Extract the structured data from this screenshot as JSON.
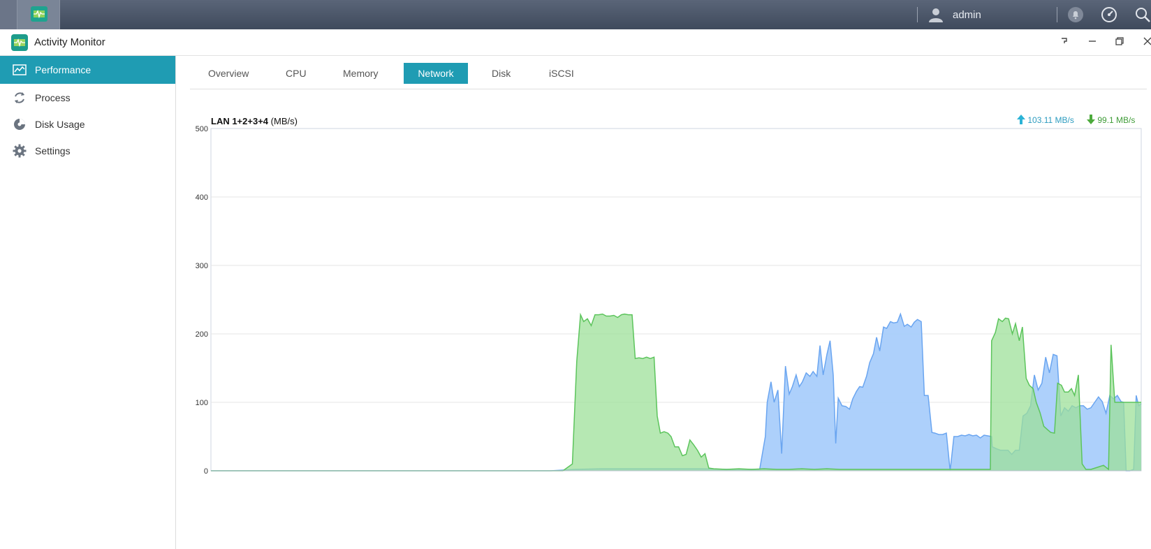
{
  "taskbar": {
    "user_name": "admin"
  },
  "window": {
    "title": "Activity Monitor"
  },
  "sidebar": {
    "items": [
      {
        "label": "Performance",
        "icon": "performance-chart-icon",
        "active": true
      },
      {
        "label": "Process",
        "icon": "process-refresh-icon",
        "active": false
      },
      {
        "label": "Disk Usage",
        "icon": "disk-usage-icon",
        "active": false
      },
      {
        "label": "Settings",
        "icon": "gear-icon",
        "active": false
      }
    ]
  },
  "tabs": [
    {
      "label": "Overview",
      "active": false
    },
    {
      "label": "CPU",
      "active": false
    },
    {
      "label": "Memory",
      "active": false
    },
    {
      "label": "Network",
      "active": true
    },
    {
      "label": "Disk",
      "active": false
    },
    {
      "label": "iSCSI",
      "active": false
    }
  ],
  "chart_data": {
    "type": "area",
    "title": "LAN 1+2+3+4",
    "unit": "(MB/s)",
    "ylim": [
      0,
      500
    ],
    "yticks": [
      "500",
      "400",
      "300",
      "200",
      "100",
      "0"
    ],
    "grid": true,
    "legend": [
      {
        "value": "103.11 MB/s",
        "direction": "up",
        "color": "#2bb3d6"
      },
      {
        "value": "99.1 MB/s",
        "direction": "down",
        "color": "#4caa3c"
      }
    ],
    "series": [
      {
        "color": "#6aa5f0",
        "fill": "#a9cdfb",
        "points": [
          [
            0,
            0
          ],
          [
            51,
            0
          ],
          [
            54,
            0
          ],
          [
            58,
            2
          ],
          [
            62,
            3
          ],
          [
            66,
            3
          ],
          [
            70,
            3
          ],
          [
            74,
            3
          ],
          [
            78,
            3
          ],
          [
            82,
            2
          ],
          [
            86,
            2
          ],
          [
            87.3,
            2
          ],
          [
            88.2,
            50
          ],
          [
            88.5,
            100
          ],
          [
            89.1,
            130
          ],
          [
            89.6,
            100
          ],
          [
            90.2,
            118
          ],
          [
            90.8,
            25
          ],
          [
            91.4,
            153
          ],
          [
            92.0,
            112
          ],
          [
            92.5,
            123
          ],
          [
            93.1,
            140
          ],
          [
            93.6,
            123
          ],
          [
            94.1,
            130
          ],
          [
            94.7,
            143
          ],
          [
            95.3,
            138
          ],
          [
            95.8,
            145
          ],
          [
            96.4,
            138
          ],
          [
            96.9,
            183
          ],
          [
            97.4,
            140
          ],
          [
            98.0,
            170
          ],
          [
            98.5,
            190
          ],
          [
            99.0,
            140
          ],
          [
            99.4,
            40
          ],
          [
            99.8,
            106
          ],
          [
            100.4,
            95
          ],
          [
            101.0,
            94
          ],
          [
            101.6,
            90
          ],
          [
            102.1,
            105
          ],
          [
            102.7,
            116
          ],
          [
            103.2,
            123
          ],
          [
            103.7,
            122
          ],
          [
            104.3,
            138
          ],
          [
            104.8,
            158
          ],
          [
            105.4,
            171
          ],
          [
            105.9,
            195
          ],
          [
            106.4,
            175
          ],
          [
            107.0,
            210
          ],
          [
            107.5,
            208
          ],
          [
            108.1,
            218
          ],
          [
            108.6,
            216
          ],
          [
            109.2,
            217
          ],
          [
            109.7,
            229
          ],
          [
            110.3,
            211
          ],
          [
            110.8,
            214
          ],
          [
            111.4,
            210
          ],
          [
            111.9,
            217
          ],
          [
            112.4,
            221
          ],
          [
            113.0,
            218
          ],
          [
            113.5,
            110
          ],
          [
            114.1,
            110
          ],
          [
            114.7,
            56
          ],
          [
            115.2,
            55
          ],
          [
            115.8,
            53
          ],
          [
            116.4,
            53
          ],
          [
            117.0,
            55
          ],
          [
            117.6,
            0
          ],
          [
            118.2,
            50
          ],
          [
            118.8,
            50
          ],
          [
            119.4,
            52
          ],
          [
            120,
            51
          ],
          [
            120.6,
            53
          ],
          [
            121.2,
            51
          ],
          [
            121.8,
            52
          ],
          [
            122.4,
            48
          ],
          [
            123.0,
            52
          ],
          [
            123.6,
            51
          ],
          [
            124.2,
            50
          ],
          [
            124.3,
            35
          ],
          [
            125.0,
            32
          ],
          [
            125.6,
            30
          ],
          [
            126.2,
            30
          ],
          [
            126.8,
            30
          ],
          [
            127.4,
            24
          ],
          [
            128.0,
            30
          ],
          [
            128.6,
            30
          ],
          [
            129.2,
            80
          ],
          [
            129.8,
            84
          ],
          [
            130.4,
            95
          ],
          [
            131.0,
            140
          ],
          [
            131.6,
            118
          ],
          [
            132.2,
            128
          ],
          [
            132.8,
            166
          ],
          [
            133.4,
            143
          ],
          [
            134.0,
            170
          ],
          [
            134.6,
            168
          ],
          [
            135.2,
            80
          ],
          [
            135.8,
            92
          ],
          [
            136.4,
            87
          ],
          [
            137.0,
            95
          ],
          [
            137.6,
            92
          ],
          [
            138.2,
            95
          ],
          [
            138.8,
            95
          ],
          [
            139.4,
            90
          ],
          [
            140.0,
            92
          ],
          [
            140.6,
            100
          ],
          [
            141.2,
            108
          ],
          [
            141.8,
            101
          ],
          [
            142.4,
            84
          ],
          [
            143.0,
            110
          ],
          [
            143.6,
            105
          ],
          [
            144.2,
            110
          ],
          [
            144.8,
            101
          ],
          [
            145.2,
            100
          ],
          [
            145.6,
            0
          ],
          [
            146.2,
            0
          ],
          [
            146.8,
            2
          ],
          [
            147.2,
            110
          ],
          [
            147.6,
            95
          ],
          [
            148,
            98
          ]
        ]
      },
      {
        "color": "#5cc45c",
        "fill": "#9ee09a",
        "points": [
          [
            0,
            0
          ],
          [
            51,
            0
          ],
          [
            54,
            0
          ],
          [
            56,
            0
          ],
          [
            57.5,
            10
          ],
          [
            58.2,
            160
          ],
          [
            58.8,
            228
          ],
          [
            59.3,
            218
          ],
          [
            59.9,
            222
          ],
          [
            60.5,
            212
          ],
          [
            61.1,
            228
          ],
          [
            61.7,
            228
          ],
          [
            62.3,
            229
          ],
          [
            62.9,
            226
          ],
          [
            63.5,
            226
          ],
          [
            64.1,
            227
          ],
          [
            64.7,
            224
          ],
          [
            65.3,
            228
          ],
          [
            65.8,
            229
          ],
          [
            66.4,
            228
          ],
          [
            67.0,
            228
          ],
          [
            67.5,
            164
          ],
          [
            68.1,
            165
          ],
          [
            68.7,
            164
          ],
          [
            69.3,
            166
          ],
          [
            69.9,
            164
          ],
          [
            70.5,
            166
          ],
          [
            71.0,
            80
          ],
          [
            71.5,
            55
          ],
          [
            72.1,
            57
          ],
          [
            72.7,
            55
          ],
          [
            73.2,
            50
          ],
          [
            73.8,
            35
          ],
          [
            74.4,
            35
          ],
          [
            75.0,
            22
          ],
          [
            75.6,
            24
          ],
          [
            76.2,
            45
          ],
          [
            76.8,
            38
          ],
          [
            77.4,
            30
          ],
          [
            78.0,
            20
          ],
          [
            78.6,
            25
          ],
          [
            79.2,
            4
          ],
          [
            80,
            3
          ],
          [
            82,
            2
          ],
          [
            84,
            3
          ],
          [
            86,
            2
          ],
          [
            88,
            3
          ],
          [
            90,
            2
          ],
          [
            92,
            2
          ],
          [
            94,
            3
          ],
          [
            96,
            2
          ],
          [
            98,
            3
          ],
          [
            100,
            2
          ],
          [
            102,
            2
          ],
          [
            104,
            2
          ],
          [
            106,
            2
          ],
          [
            108,
            2
          ],
          [
            110,
            2
          ],
          [
            112,
            2
          ],
          [
            114,
            2
          ],
          [
            116,
            2
          ],
          [
            118,
            2
          ],
          [
            120,
            2
          ],
          [
            122,
            2
          ],
          [
            124.0,
            2
          ],
          [
            124.2,
            190
          ],
          [
            124.8,
            202
          ],
          [
            125.3,
            222
          ],
          [
            125.9,
            218
          ],
          [
            126.4,
            223
          ],
          [
            126.9,
            222
          ],
          [
            127.5,
            200
          ],
          [
            128.0,
            215
          ],
          [
            128.6,
            190
          ],
          [
            129.1,
            210
          ],
          [
            129.7,
            135
          ],
          [
            130.2,
            125
          ],
          [
            130.8,
            120
          ],
          [
            131.3,
            100
          ],
          [
            131.9,
            85
          ],
          [
            132.5,
            65
          ],
          [
            133.1,
            60
          ],
          [
            133.6,
            56
          ],
          [
            134.2,
            55
          ],
          [
            134.7,
            128
          ],
          [
            135.3,
            125
          ],
          [
            135.8,
            115
          ],
          [
            136.4,
            115
          ],
          [
            136.9,
            120
          ],
          [
            137.4,
            110
          ],
          [
            138.0,
            140
          ],
          [
            138.6,
            10
          ],
          [
            139.2,
            2
          ],
          [
            140,
            2
          ],
          [
            141,
            5
          ],
          [
            142,
            8
          ],
          [
            142.8,
            2
          ],
          [
            143.2,
            184
          ],
          [
            143.8,
            100
          ],
          [
            148,
            100
          ]
        ]
      }
    ]
  }
}
